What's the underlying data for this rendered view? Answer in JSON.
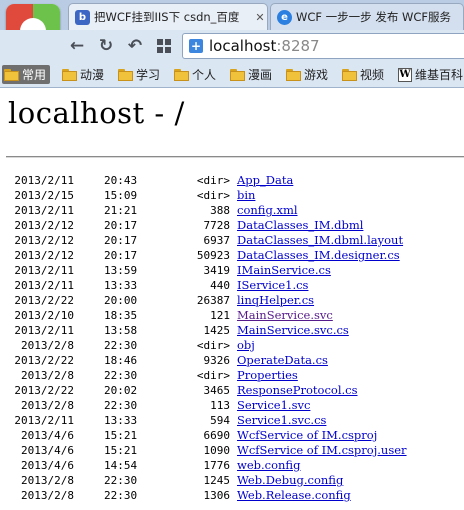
{
  "browser": {
    "tabs": [
      {
        "title": "把WCF挂到IIS下 csdn_百度",
        "active": true
      },
      {
        "title": "WCF 一步一步 发布 WCF服务",
        "active": false
      }
    ],
    "address": {
      "host": "localhost",
      "port": ":8287"
    },
    "bookmarks": [
      {
        "label": "常用",
        "icon": "folder-icon"
      },
      {
        "label": "动漫",
        "icon": "folder-icon"
      },
      {
        "label": "学习",
        "icon": "folder-icon"
      },
      {
        "label": "个人",
        "icon": "folder-icon"
      },
      {
        "label": "漫画",
        "icon": "folder-icon"
      },
      {
        "label": "游戏",
        "icon": "folder-icon"
      },
      {
        "label": "视频",
        "icon": "folder-icon"
      },
      {
        "label": "维基百科",
        "icon": "wikipedia-icon"
      }
    ]
  },
  "page": {
    "heading": "localhost - /",
    "entries": [
      {
        "date": "2013/2/11",
        "time": "20:43",
        "size": "<dir>",
        "name": "App_Data",
        "visited": false
      },
      {
        "date": "2013/2/15",
        "time": "15:09",
        "size": "<dir>",
        "name": "bin",
        "visited": false
      },
      {
        "date": "2013/2/11",
        "time": "21:21",
        "size": "388",
        "name": "config.xml",
        "visited": false
      },
      {
        "date": "2013/2/12",
        "time": "20:17",
        "size": "7728",
        "name": "DataClasses_IM.dbml",
        "visited": false
      },
      {
        "date": "2013/2/12",
        "time": "20:17",
        "size": "6937",
        "name": "DataClasses_IM.dbml.layout",
        "visited": false
      },
      {
        "date": "2013/2/12",
        "time": "20:17",
        "size": "50923",
        "name": "DataClasses_IM.designer.cs",
        "visited": false
      },
      {
        "date": "2013/2/11",
        "time": "13:59",
        "size": "3419",
        "name": "IMainService.cs",
        "visited": false
      },
      {
        "date": "2013/2/11",
        "time": "13:33",
        "size": "440",
        "name": "IService1.cs",
        "visited": false
      },
      {
        "date": "2013/2/22",
        "time": "20:00",
        "size": "26387",
        "name": "linqHelper.cs",
        "visited": false
      },
      {
        "date": "2013/2/10",
        "time": "18:35",
        "size": "121",
        "name": "MainService.svc",
        "visited": true
      },
      {
        "date": "2013/2/11",
        "time": "13:58",
        "size": "1425",
        "name": "MainService.svc.cs",
        "visited": false
      },
      {
        "date": "2013/2/8",
        "time": "22:30",
        "size": "<dir>",
        "name": "obj",
        "visited": false
      },
      {
        "date": "2013/2/22",
        "time": "18:46",
        "size": "9326",
        "name": "OperateData.cs",
        "visited": false
      },
      {
        "date": "2013/2/8",
        "time": "22:30",
        "size": "<dir>",
        "name": "Properties",
        "visited": false
      },
      {
        "date": "2013/2/22",
        "time": "20:02",
        "size": "3465",
        "name": "ResponseProtocol.cs",
        "visited": false
      },
      {
        "date": "2013/2/8",
        "time": "22:30",
        "size": "113",
        "name": "Service1.svc",
        "visited": false
      },
      {
        "date": "2013/2/11",
        "time": "13:33",
        "size": "594",
        "name": "Service1.svc.cs",
        "visited": false
      },
      {
        "date": "2013/4/6",
        "time": "15:21",
        "size": "6690",
        "name": "WcfService of IM.csproj",
        "visited": false
      },
      {
        "date": "2013/4/6",
        "time": "15:21",
        "size": "1090",
        "name": "WcfService of IM.csproj.user",
        "visited": false
      },
      {
        "date": "2013/4/6",
        "time": "14:54",
        "size": "1776",
        "name": "web.config",
        "visited": false
      },
      {
        "date": "2013/2/8",
        "time": "22:30",
        "size": "1245",
        "name": "Web.Debug.config",
        "visited": false
      },
      {
        "date": "2013/2/8",
        "time": "22:30",
        "size": "1306",
        "name": "Web.Release.config",
        "visited": false
      }
    ]
  }
}
